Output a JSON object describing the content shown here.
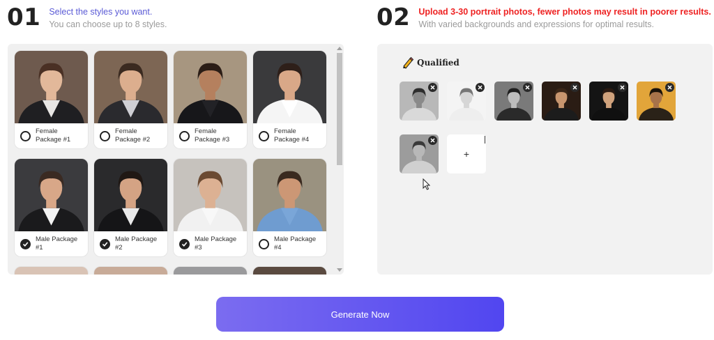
{
  "step1": {
    "number": "01",
    "title": "Select the styles you want.",
    "subtitle": "You can choose up to 8 styles."
  },
  "step2": {
    "number": "02",
    "title": "Upload 3-30 portrait photos, fewer photos may result in poorer results.",
    "subtitle": "With varied backgrounds and expressions for optimal results."
  },
  "styles": [
    {
      "label": "Female Package #1",
      "checked": false,
      "bg": "#6e5a4e",
      "skin": "#e2b89a",
      "hair": "#4a3024",
      "suit": "#1f1f22",
      "shirt": "#e8e6e4"
    },
    {
      "label": "Female Package #2",
      "checked": false,
      "bg": "#7d6654",
      "skin": "#dcae8e",
      "hair": "#3b2a20",
      "suit": "#2a2a2e",
      "shirt": "#cfcfd4"
    },
    {
      "label": "Female Package #3",
      "checked": false,
      "bg": "#a79680",
      "skin": "#b5805e",
      "hair": "#2b1d16",
      "suit": "#17171a",
      "shirt": "#222226"
    },
    {
      "label": "Female Package #4",
      "checked": false,
      "bg": "#3a3a3c",
      "skin": "#d9a888",
      "hair": "#2e1f19",
      "suit": "#f5f5f5",
      "shirt": "#ffffff"
    },
    {
      "label": "Male Package #1",
      "checked": true,
      "bg": "#3b3b3e",
      "skin": "#d8a788",
      "hair": "#3a2a22",
      "suit": "#1a1a1c",
      "shirt": "#f2f2f2"
    },
    {
      "label": "Male Package #2",
      "checked": true,
      "bg": "#2a2a2c",
      "skin": "#d4a384",
      "hair": "#201814",
      "suit": "#151517",
      "shirt": "#e9e9e9"
    },
    {
      "label": "Male Package #3",
      "checked": true,
      "bg": "#c6c2bd",
      "skin": "#dcb193",
      "hair": "#6b4a32",
      "suit": "#f1f1f1",
      "shirt": "#f8f8f8"
    },
    {
      "label": "Male Package #4",
      "checked": false,
      "bg": "#9a9280",
      "skin": "#cc9775",
      "hair": "#3a2a1f",
      "suit": "#6f9cd0",
      "shirt": "#7aa6d8"
    }
  ],
  "partial_styles": [
    {
      "bg": "#d9c3b5"
    },
    {
      "bg": "#c8ab98"
    },
    {
      "bg": "#9a9a9c"
    },
    {
      "bg": "#5a4a40"
    }
  ],
  "qualified": {
    "label": "Qualified",
    "photos": [
      {
        "name": "uploaded-photo-1",
        "bg": "#b8b8b8",
        "skin": "#8a8a8a",
        "hair": "#2e2e2e",
        "shirt": "#d9d9d9"
      },
      {
        "name": "uploaded-photo-2",
        "bg": "#f4f4f4",
        "skin": "#d6d6d6",
        "hair": "#777777",
        "shirt": "#eeeeee"
      },
      {
        "name": "uploaded-photo-3",
        "bg": "#7a7a7a",
        "skin": "#bdbdbd",
        "hair": "#1f1f1f",
        "shirt": "#2a2a2a"
      },
      {
        "name": "uploaded-photo-4",
        "bg": "#2a1c14",
        "skin": "#c8956e",
        "hair": "#3a2618",
        "shirt": "#1c1c1c"
      },
      {
        "name": "uploaded-photo-5",
        "bg": "#141414",
        "skin": "#d0a27c",
        "hair": "#2a1a12",
        "shirt": "#101010"
      },
      {
        "name": "uploaded-photo-6",
        "bg": "#e2a53a",
        "skin": "#a8734a",
        "hair": "#1a1209",
        "shirt": "#2a2218"
      },
      {
        "name": "uploaded-photo-7",
        "bg": "#9c9c9c",
        "skin": "#b8b8b8",
        "hair": "#3a3a3a",
        "shirt": "#d0d0d0"
      }
    ],
    "add_label": "+"
  },
  "generate_button": "Generate Now",
  "colors": {
    "step1_title": "#5b5bd6",
    "step2_title": "#ee2222",
    "button_start": "#7b6cf0",
    "button_end": "#5146f0",
    "panel_bg": "#f0f0f0"
  }
}
